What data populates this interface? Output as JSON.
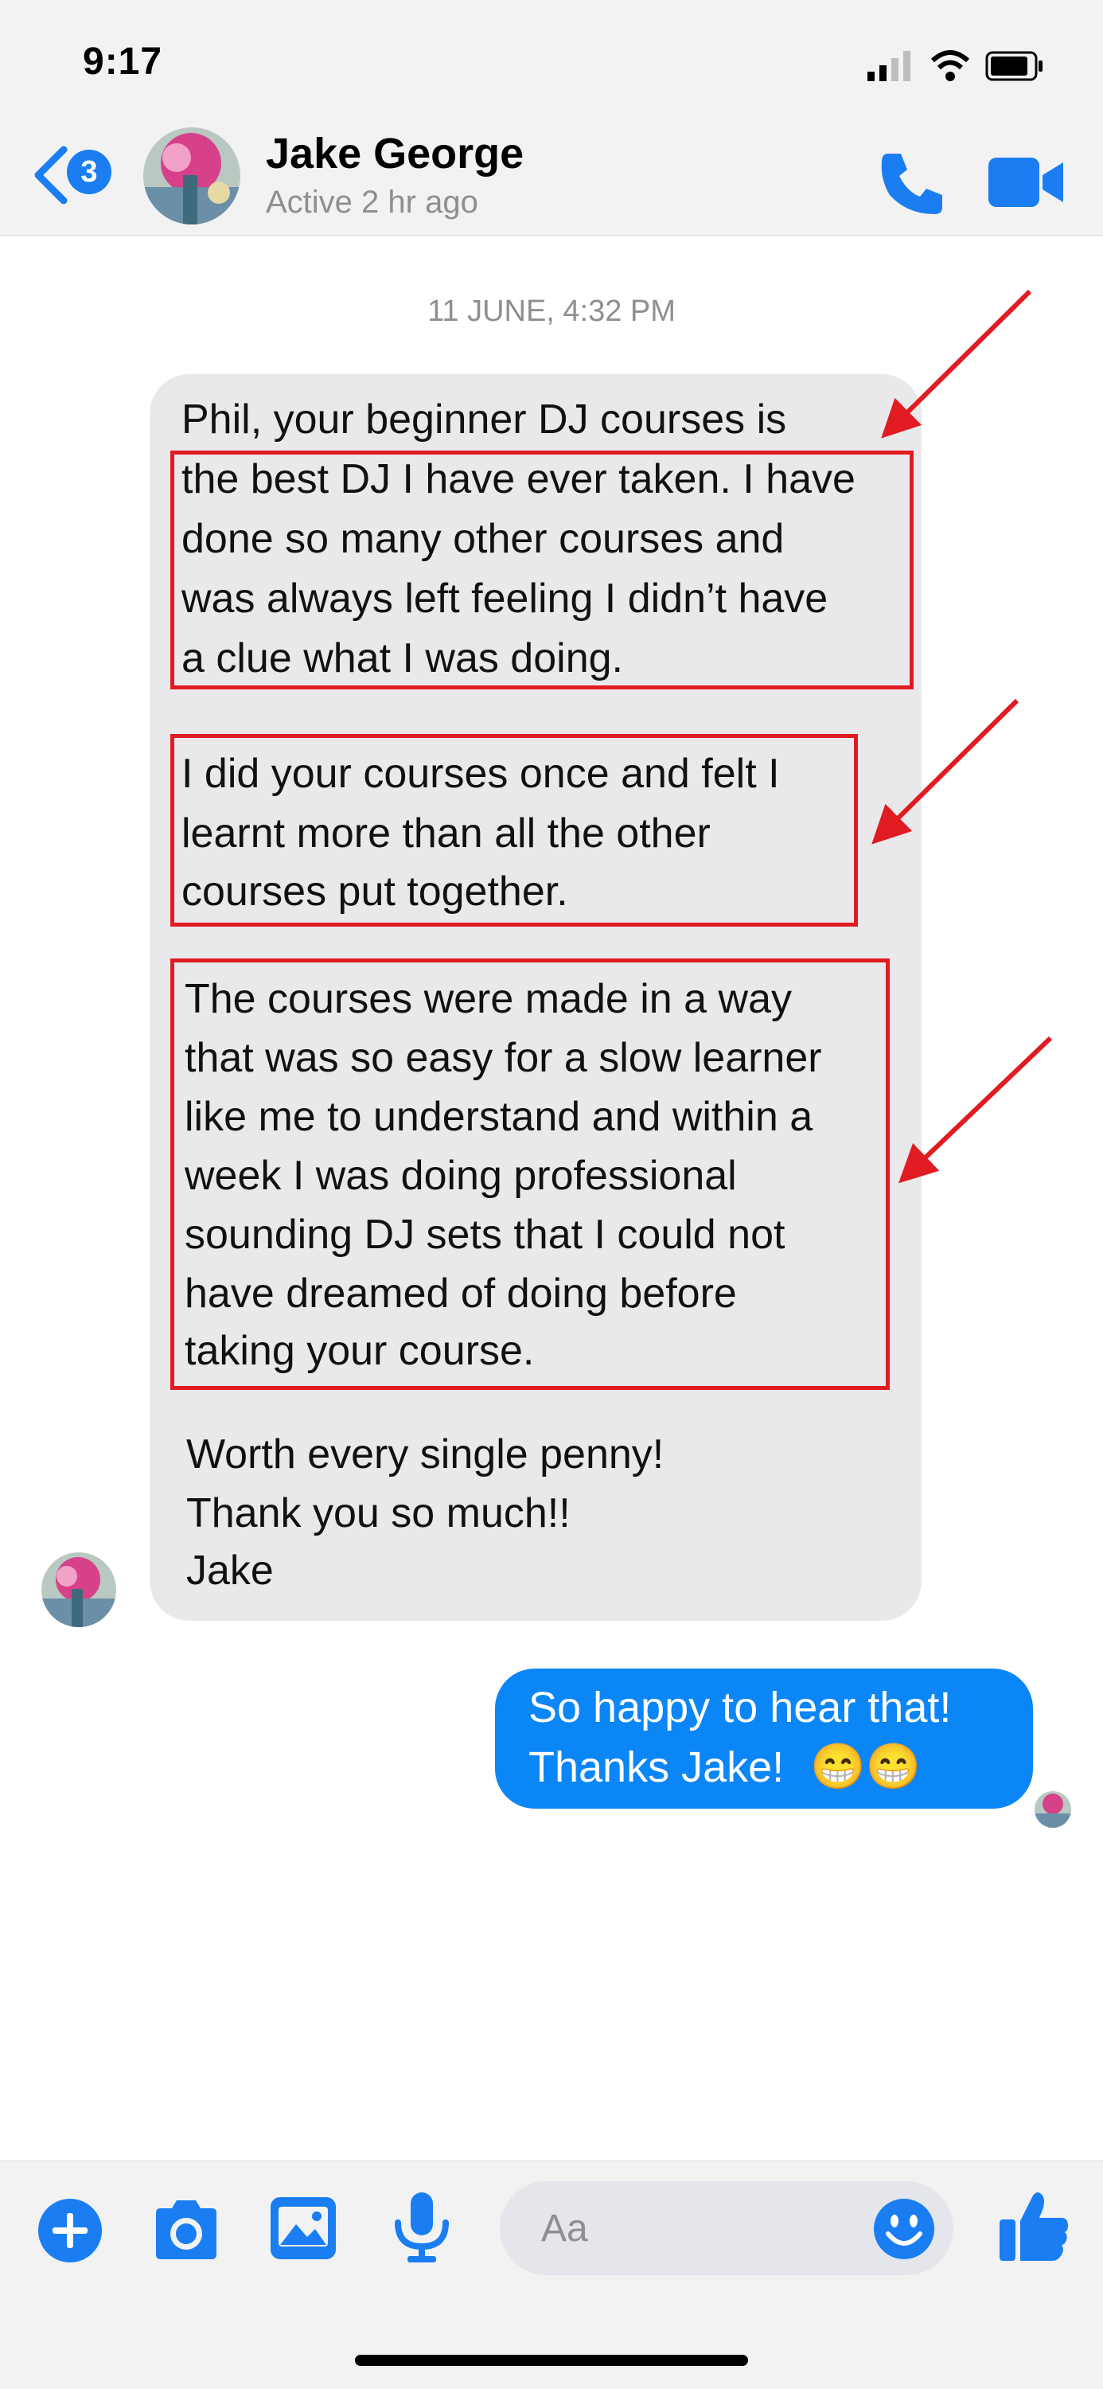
{
  "status_bar": {
    "time": "9:17"
  },
  "header": {
    "back_badge": "3",
    "contact_name": "Jake George",
    "contact_status": "Active 2 hr ago"
  },
  "conversation": {
    "timestamp": "11 JUNE, 4:32 PM",
    "incoming_lines": [
      "Phil, your beginner DJ courses is",
      "the best DJ I have ever taken. I have",
      "done so many other courses and",
      "was always left feeling I didn’t have",
      "a clue what I was doing.",
      "I did your courses once and felt I",
      "learnt more than all the other",
      "courses put together.",
      "The courses were made in a way",
      "that was so easy for a slow learner",
      "like me to understand and within a",
      "week I was doing professional",
      "sounding DJ sets that I could not",
      "have dreamed of doing before",
      "taking your course.",
      "Worth every single penny!",
      "Thank you so much!!",
      "Jake"
    ],
    "outgoing_lines": [
      "So happy to hear that!",
      "Thanks Jake!"
    ],
    "outgoing_emoji": "😁😁"
  },
  "composer": {
    "placeholder": "Aa"
  },
  "colors": {
    "accent": "#1a7ef2",
    "outgoing_bubble": "#0b86f7",
    "incoming_bubble": "#e9e9eb",
    "highlight": "#e11b22"
  }
}
